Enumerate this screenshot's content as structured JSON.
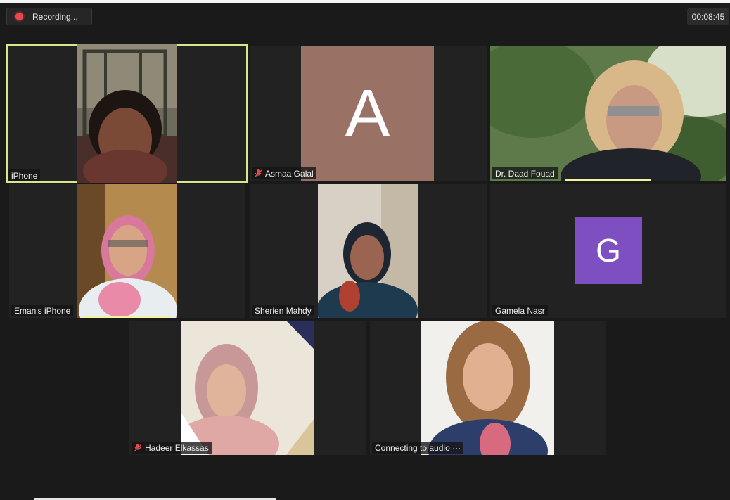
{
  "recording": {
    "label": "Recording...",
    "icon": "record-dot-icon",
    "color": "#e5484d"
  },
  "timer": {
    "value": "00:08:45"
  },
  "participants": [
    {
      "name": "iPhone",
      "video": true,
      "muted": false,
      "active_speaker": true
    },
    {
      "name": "Asmaa Galal",
      "video": false,
      "avatar_letter": "A",
      "avatar_color": "#9a7265",
      "muted": true
    },
    {
      "name": "Dr. Daad Fouad",
      "video": true,
      "muted": false,
      "speaking": true
    },
    {
      "name": "Eman's iPhone",
      "video": true,
      "muted": false,
      "speaking": true
    },
    {
      "name": "Sherien Mahdy",
      "video": true,
      "muted": false
    },
    {
      "name": "Gamela Nasr",
      "video": false,
      "avatar_letter": "G",
      "avatar_color": "#7e4fc1",
      "muted": false
    },
    {
      "name": "Hadeer Elkassas",
      "video": true,
      "muted": true
    },
    {
      "name": "Connecting to audio ···",
      "video": true,
      "muted": false
    }
  ],
  "colors": {
    "active_outline": "#d6e88a",
    "speaking_bar": "#f4f1a0",
    "mute_icon": "#e5484d"
  }
}
